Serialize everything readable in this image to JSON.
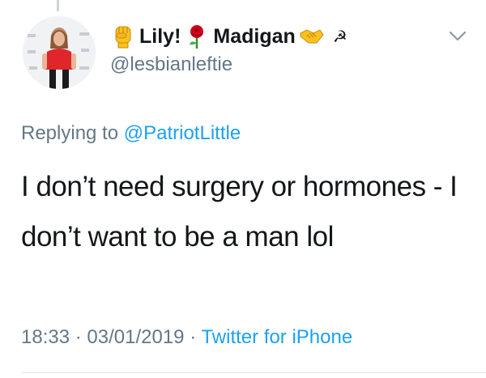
{
  "tweet": {
    "display_name": {
      "segments": [
        "Lily!",
        "Madigan"
      ],
      "trailing_symbol": "☭",
      "emojis": [
        "raised-fist",
        "rose",
        "handshake"
      ]
    },
    "handle": "@lesbianleftie",
    "reply_prefix": "Replying to",
    "reply_to": "@PatriotLittle",
    "text": "I don’t need surgery or hormones - I don’t want to be a man lol",
    "time": "18:33",
    "separator": "·",
    "date": "03/01/2019",
    "source": "Twitter for iPhone"
  },
  "colors": {
    "text": "#14171a",
    "secondary": "#657786",
    "link": "#1da1f2",
    "divider": "#e1e8ed"
  },
  "icons": {
    "menu": "chevron-down-icon"
  }
}
